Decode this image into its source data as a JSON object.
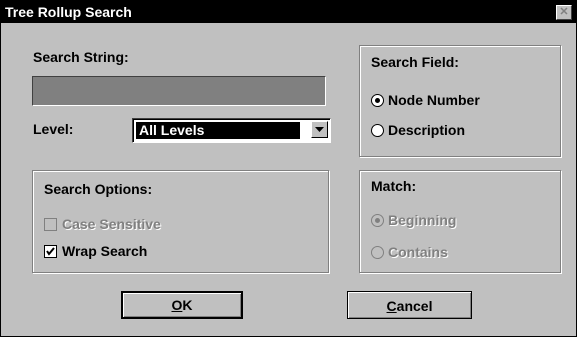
{
  "window": {
    "title": "Tree Rollup Search",
    "close_glyph": "✕"
  },
  "search": {
    "label": "Search String:",
    "value": ""
  },
  "level": {
    "label": "Level:",
    "selected": "All Levels"
  },
  "search_options": {
    "title": "Search Options:",
    "case_sensitive": {
      "label": "Case Sensitive",
      "checked": false,
      "enabled": false
    },
    "wrap_search": {
      "label": "Wrap Search",
      "checked": true,
      "enabled": true
    }
  },
  "search_field": {
    "title": "Search Field:",
    "node_number": {
      "label": "Node Number",
      "selected": true
    },
    "description": {
      "label": "Description",
      "selected": false
    }
  },
  "match": {
    "title": "Match:",
    "beginning": {
      "label": "Beginning",
      "selected": true,
      "enabled": false
    },
    "contains": {
      "label": "Contains",
      "selected": false,
      "enabled": false
    }
  },
  "buttons": {
    "ok": {
      "mnemonic": "O",
      "rest": "K"
    },
    "cancel": {
      "mnemonic": "C",
      "rest": "ancel"
    }
  },
  "icons": {
    "close": "close-icon",
    "dropdown": "chevron-down-icon",
    "check": "checkmark-icon"
  }
}
